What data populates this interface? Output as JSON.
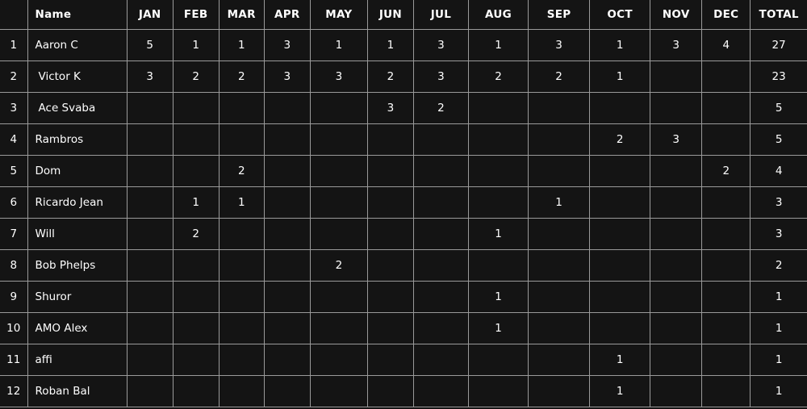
{
  "table": {
    "columns": [
      {
        "key": "rank",
        "label": "",
        "class": "col-rank"
      },
      {
        "key": "name",
        "label": "Name",
        "class": "col-name"
      },
      {
        "key": "jan",
        "label": "JAN",
        "class": "m-jan"
      },
      {
        "key": "feb",
        "label": "FEB",
        "class": "m-feb"
      },
      {
        "key": "mar",
        "label": "MAR",
        "class": "m-mar"
      },
      {
        "key": "apr",
        "label": "APR",
        "class": "m-apr"
      },
      {
        "key": "may",
        "label": "MAY",
        "class": "m-may"
      },
      {
        "key": "jun",
        "label": "JUN",
        "class": "m-jun"
      },
      {
        "key": "jul",
        "label": "JUL",
        "class": "m-jul"
      },
      {
        "key": "aug",
        "label": "AUG",
        "class": "m-aug"
      },
      {
        "key": "sep",
        "label": "SEP",
        "class": "m-sep"
      },
      {
        "key": "oct",
        "label": "OCT",
        "class": "m-oct"
      },
      {
        "key": "nov",
        "label": "NOV",
        "class": "m-nov"
      },
      {
        "key": "dec",
        "label": "DEC",
        "class": "m-dec"
      },
      {
        "key": "total",
        "label": "TOTAL",
        "class": "col-total"
      }
    ],
    "headers": {
      "rank": "",
      "name": "Name",
      "jan": "JAN",
      "feb": "FEB",
      "mar": "MAR",
      "apr": "APR",
      "may": "MAY",
      "jun": "JUN",
      "jul": "JUL",
      "aug": "AUG",
      "sep": "SEP",
      "oct": "OCT",
      "nov": "NOV",
      "dec": "DEC",
      "total": "TOTAL"
    },
    "rows": [
      {
        "rank": "1",
        "name": "Aaron C",
        "indent": false,
        "jan": "5",
        "feb": "1",
        "mar": "1",
        "apr": "3",
        "may": "1",
        "jun": "1",
        "jul": "3",
        "aug": "1",
        "sep": "3",
        "oct": "1",
        "nov": "3",
        "dec": "4",
        "total": "27"
      },
      {
        "rank": "2",
        "name": "Victor K",
        "indent": true,
        "jan": "3",
        "feb": "2",
        "mar": "2",
        "apr": "3",
        "may": "3",
        "jun": "2",
        "jul": "3",
        "aug": "2",
        "sep": "2",
        "oct": "1",
        "nov": "",
        "dec": "",
        "total": "23"
      },
      {
        "rank": "3",
        "name": "Ace Svaba",
        "indent": true,
        "jan": "",
        "feb": "",
        "mar": "",
        "apr": "",
        "may": "",
        "jun": "3",
        "jul": "2",
        "aug": "",
        "sep": "",
        "oct": "",
        "nov": "",
        "dec": "",
        "total": "5"
      },
      {
        "rank": "4",
        "name": "Rambros",
        "indent": false,
        "jan": "",
        "feb": "",
        "mar": "",
        "apr": "",
        "may": "",
        "jun": "",
        "jul": "",
        "aug": "",
        "sep": "",
        "oct": "2",
        "nov": "3",
        "dec": "",
        "total": "5"
      },
      {
        "rank": "5",
        "name": "Dom",
        "indent": false,
        "jan": "",
        "feb": "",
        "mar": "2",
        "apr": "",
        "may": "",
        "jun": "",
        "jul": "",
        "aug": "",
        "sep": "",
        "oct": "",
        "nov": "",
        "dec": "2",
        "total": "4"
      },
      {
        "rank": "6",
        "name": "Ricardo Jean",
        "indent": false,
        "jan": "",
        "feb": "1",
        "mar": "1",
        "apr": "",
        "may": "",
        "jun": "",
        "jul": "",
        "aug": "",
        "sep": "1",
        "oct": "",
        "nov": "",
        "dec": "",
        "total": "3"
      },
      {
        "rank": "7",
        "name": "Will",
        "indent": false,
        "jan": "",
        "feb": "2",
        "mar": "",
        "apr": "",
        "may": "",
        "jun": "",
        "jul": "",
        "aug": "1",
        "sep": "",
        "oct": "",
        "nov": "",
        "dec": "",
        "total": "3"
      },
      {
        "rank": "8",
        "name": "Bob Phelps",
        "indent": false,
        "jan": "",
        "feb": "",
        "mar": "",
        "apr": "",
        "may": "2",
        "jun": "",
        "jul": "",
        "aug": "",
        "sep": "",
        "oct": "",
        "nov": "",
        "dec": "",
        "total": "2"
      },
      {
        "rank": "9",
        "name": "Shuror",
        "indent": false,
        "jan": "",
        "feb": "",
        "mar": "",
        "apr": "",
        "may": "",
        "jun": "",
        "jul": "",
        "aug": "1",
        "sep": "",
        "oct": "",
        "nov": "",
        "dec": "",
        "total": "1"
      },
      {
        "rank": "10",
        "name": "AMO Alex",
        "indent": false,
        "jan": "",
        "feb": "",
        "mar": "",
        "apr": "",
        "may": "",
        "jun": "",
        "jul": "",
        "aug": "1",
        "sep": "",
        "oct": "",
        "nov": "",
        "dec": "",
        "total": "1"
      },
      {
        "rank": "11",
        "name": "affi",
        "indent": false,
        "jan": "",
        "feb": "",
        "mar": "",
        "apr": "",
        "may": "",
        "jun": "",
        "jul": "",
        "aug": "",
        "sep": "",
        "oct": "1",
        "nov": "",
        "dec": "",
        "total": "1"
      },
      {
        "rank": "12",
        "name": "Roban Bal",
        "indent": false,
        "jan": "",
        "feb": "",
        "mar": "",
        "apr": "",
        "may": "",
        "jun": "",
        "jul": "",
        "aug": "",
        "sep": "",
        "oct": "1",
        "nov": "",
        "dec": "",
        "total": "1"
      }
    ]
  },
  "colors": {
    "background": "#141414",
    "border": "#9a9a9a",
    "text": "#ffffff"
  }
}
